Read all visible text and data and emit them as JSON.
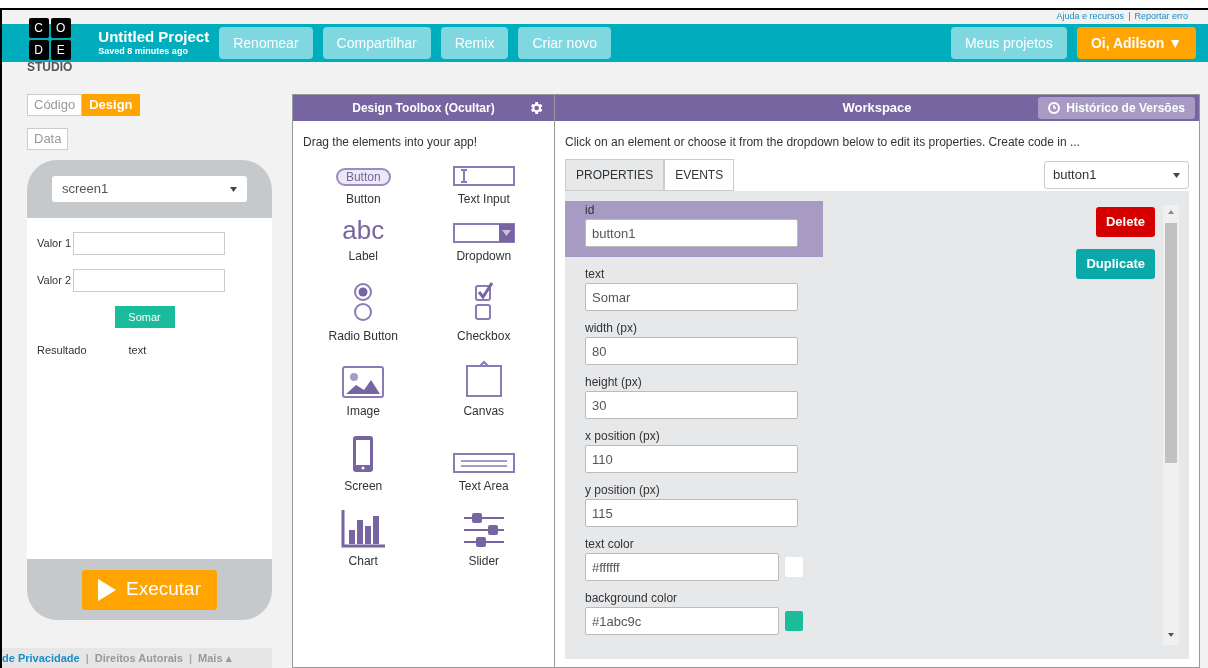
{
  "top_links": [
    {
      "label": "Ajuda e recursos",
      "kind": "link"
    },
    {
      "label": "|",
      "kind": "separator"
    },
    {
      "label": "Reportar erro",
      "kind": "link"
    }
  ],
  "logo": {
    "letters": [
      "C",
      "O",
      "D",
      "E"
    ],
    "subtitle": "STUDIO"
  },
  "project": {
    "title": "Untitled Project",
    "saved": "Saved 8 minutes ago"
  },
  "header_buttons": [
    {
      "label": "Renomear"
    },
    {
      "label": "Compartilhar"
    },
    {
      "label": "Remix"
    },
    {
      "label": "Criar novo"
    }
  ],
  "right_buttons": [
    {
      "label": "Meus projetos",
      "kind": "secondary"
    },
    {
      "label": "Oi, Adilson ▼",
      "kind": "primary"
    }
  ],
  "mode_tabs": [
    {
      "label": "Código",
      "selected": false
    },
    {
      "label": "Design",
      "selected": true
    }
  ],
  "data_button": {
    "label": "Data"
  },
  "preview": {
    "screen_select": "screen1",
    "elements": [
      {
        "kind": "label",
        "text": "Valor 1"
      },
      {
        "kind": "input"
      },
      {
        "kind": "label",
        "text": "Valor 2"
      },
      {
        "kind": "input"
      },
      {
        "kind": "button",
        "text": "Somar"
      },
      {
        "kind": "label",
        "text": "Resultado"
      },
      {
        "kind": "label",
        "text": "text"
      }
    ],
    "run_button": "Executar"
  },
  "footer_links": [
    {
      "label": "de Privacidade",
      "kind": "link",
      "highlight": true
    },
    {
      "label": "|",
      "kind": "separator"
    },
    {
      "label": "Direitos Autorais",
      "kind": "link",
      "highlight": false
    },
    {
      "label": "|",
      "kind": "separator"
    },
    {
      "label": "Mais ▴",
      "kind": "link",
      "highlight": false
    }
  ],
  "toolbox": {
    "title": "Design Toolbox (Ocultar)",
    "hint": "Drag the elements into your app!",
    "items": [
      {
        "kind": "button",
        "label": "Button",
        "icon_text": "Button"
      },
      {
        "kind": "text_input",
        "label": "Text Input"
      },
      {
        "kind": "label",
        "label": "Label",
        "icon_text": "abc"
      },
      {
        "kind": "dropdown",
        "label": "Dropdown"
      },
      {
        "kind": "radio",
        "label": "Radio Button"
      },
      {
        "kind": "checkbox",
        "label": "Checkbox"
      },
      {
        "kind": "image",
        "label": "Image"
      },
      {
        "kind": "canvas",
        "label": "Canvas"
      },
      {
        "kind": "screen",
        "label": "Screen"
      },
      {
        "kind": "text_area",
        "label": "Text Area"
      },
      {
        "kind": "chart",
        "label": "Chart"
      },
      {
        "kind": "slider",
        "label": "Slider"
      }
    ]
  },
  "workspace": {
    "title": "Workspace",
    "history_button": "Histórico de Versões",
    "hint": "Click on an element or choose it from the dropdown below to edit its properties. Create code in ...",
    "tabs": [
      {
        "label": "PROPERTIES",
        "selected": true
      },
      {
        "label": "EVENTS",
        "selected": false
      }
    ],
    "element_select": "button1",
    "properties": [
      {
        "label": "id",
        "value": "button1",
        "selected": true
      },
      {
        "label": "text",
        "value": "Somar",
        "selected": false
      },
      {
        "label": "width (px)",
        "value": "80",
        "selected": false
      },
      {
        "label": "height (px)",
        "value": "30",
        "selected": false
      },
      {
        "label": "x position (px)",
        "value": "110",
        "selected": false
      },
      {
        "label": "y position (px)",
        "value": "115",
        "selected": false
      },
      {
        "label": "text color",
        "value": "#ffffff",
        "selected": false,
        "color": "#ffffff"
      },
      {
        "label": "background color",
        "value": "#1abc9c",
        "selected": false,
        "color": "#1abc9c"
      }
    ],
    "actions": [
      {
        "label": "Delete",
        "kind": "danger"
      },
      {
        "label": "Duplicate",
        "kind": "copy"
      }
    ]
  }
}
